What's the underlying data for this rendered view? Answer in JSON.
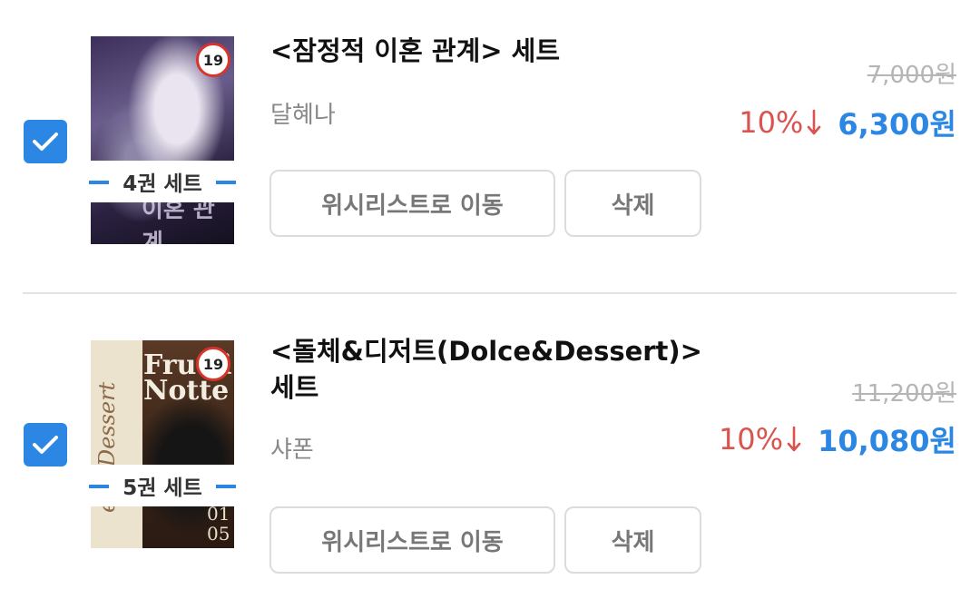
{
  "colors": {
    "accent": "#2b87e3",
    "discount": "#d9534f",
    "muted": "#888888"
  },
  "items": [
    {
      "checked": true,
      "age_rating": "19",
      "set_label": "4권 세트",
      "cover_text": "이혼 관계",
      "title": "<잠정적 이혼 관계> 세트",
      "author": "달혜나",
      "original_price": "7,000원",
      "discount": "10%",
      "final_price": "6,300원",
      "wishlist_label": "위시리스트로 이동",
      "delete_label": "삭제"
    },
    {
      "checked": true,
      "age_rating": "19",
      "set_label": "5권 세트",
      "cover_text": "Frutti Notte",
      "cover_side_text": "e & Dessert",
      "cover_volume": "01 05",
      "title": "<돌체&디저트(Dolce&Dessert)> 세트",
      "author": "샤폰",
      "original_price": "11,200원",
      "discount": "10%",
      "final_price": "10,080원",
      "wishlist_label": "위시리스트로 이동",
      "delete_label": "삭제"
    }
  ]
}
